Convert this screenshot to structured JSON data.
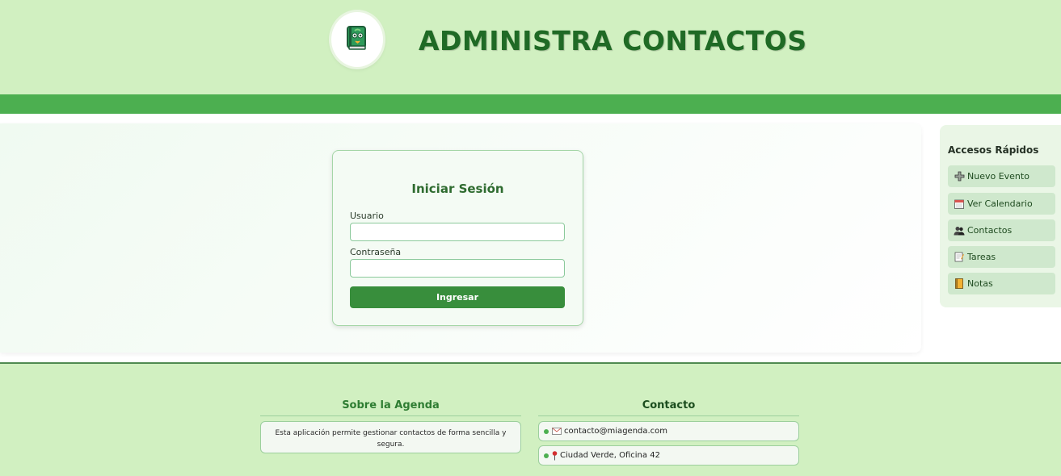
{
  "header": {
    "title": "ADMINISTRA CONTACTOS",
    "logo_icon": "agenda-book-icon"
  },
  "login": {
    "title": "Iniciar Sesión",
    "username_label": "Usuario",
    "username_value": "",
    "password_label": "Contraseña",
    "password_value": "",
    "submit_label": "Ingresar"
  },
  "sidebar": {
    "title": "Accesos Rápidos",
    "items": [
      {
        "label": "Nuevo Evento",
        "icon": "plus-icon"
      },
      {
        "label": "Ver Calendario",
        "icon": "calendar-icon"
      },
      {
        "label": "Contactos",
        "icon": "people-icon"
      },
      {
        "label": "Tareas",
        "icon": "memo-icon"
      },
      {
        "label": "Notas",
        "icon": "notebook-icon"
      }
    ]
  },
  "footer": {
    "about": {
      "heading": "Sobre la Agenda",
      "text": "Esta aplicación permite gestionar contactos de forma sencilla y segura."
    },
    "contact": {
      "heading": "Contacto",
      "email": "contacto@miagenda.com",
      "address": "Ciudad Verde, Oficina 42"
    }
  },
  "colors": {
    "header_bg": "#d1f0c1",
    "accent_bar": "#4caf50",
    "title_text": "#1f6a25",
    "button_bg": "#388e3c"
  }
}
